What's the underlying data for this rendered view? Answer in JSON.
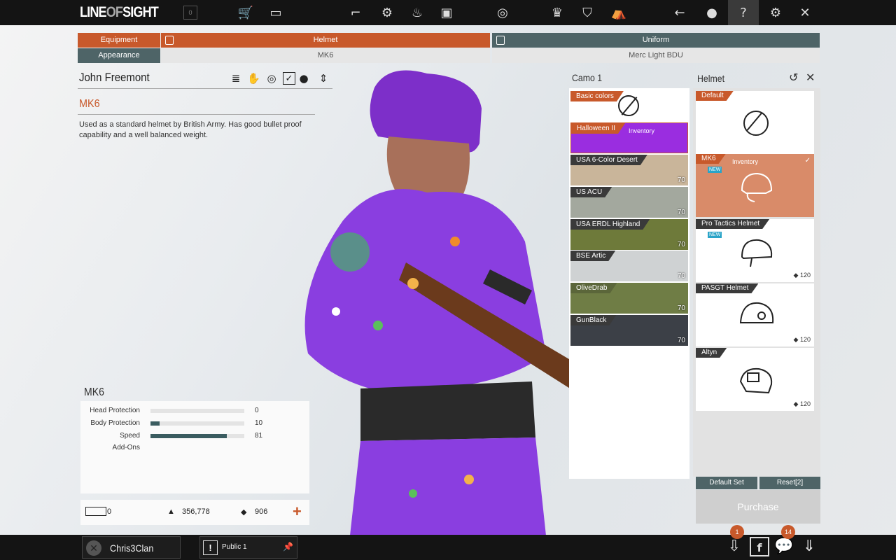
{
  "app": {
    "logo_left": "LINE",
    "logo_of": "OF",
    "logo_right": "SIGHT",
    "level": "0"
  },
  "tabs": {
    "equipment": "Equipment",
    "appearance": "Appearance",
    "helmet": "Helmet",
    "helmet_item": "MK6",
    "uniform": "Uniform",
    "uniform_item": "Merc Light BDU"
  },
  "character": {
    "name": "John Freemont"
  },
  "item": {
    "name": "MK6",
    "description": "Used as a standard helmet by British Army. Has good bullet proof capability and a well balanced weight."
  },
  "stats": {
    "title": "MK6",
    "rows": [
      {
        "label": "Head Protection",
        "value": "0",
        "fraction": 0
      },
      {
        "label": "Body Protection",
        "value": "10",
        "fraction": 0.1
      },
      {
        "label": "Speed",
        "value": "81",
        "fraction": 0.81
      }
    ],
    "addons_label": "Add-Ons"
  },
  "currency": {
    "coupons": "0",
    "gp": "356,778",
    "zp": "906",
    "plus": "+"
  },
  "camo": {
    "title": "Camo 1",
    "items": [
      {
        "name": "Basic colors",
        "price": "",
        "tag": ""
      },
      {
        "name": "Halloween II",
        "price": "",
        "tag": "Inventory"
      },
      {
        "name": "USA 6-Color Desert",
        "price": "70",
        "tag": ""
      },
      {
        "name": "US ACU",
        "price": "70",
        "tag": ""
      },
      {
        "name": "USA ERDL Highland",
        "price": "70",
        "tag": ""
      },
      {
        "name": "BSE Artic",
        "price": "70",
        "tag": ""
      },
      {
        "name": "OliveDrab",
        "price": "70",
        "tag": ""
      },
      {
        "name": "GunBlack",
        "price": "70",
        "tag": ""
      }
    ]
  },
  "helmet_panel": {
    "title": "Helmet",
    "items": [
      {
        "name": "Default",
        "price": "",
        "tag": "",
        "new": ""
      },
      {
        "name": "MK6",
        "price": "",
        "tag": "Inventory",
        "new": "NEW"
      },
      {
        "name": "Pro Tactics Helmet",
        "price": "120",
        "tag": "",
        "new": "NEW"
      },
      {
        "name": "PASGT Helmet",
        "price": "120",
        "tag": "",
        "new": ""
      },
      {
        "name": "Altyn",
        "price": "120",
        "tag": "",
        "new": ""
      }
    ],
    "default_set": "Default Set",
    "reset": "Reset[2]",
    "purchase": "Purchase"
  },
  "bottom": {
    "clan_name": "Chris3Clan",
    "chat_room": "Public 1",
    "download_badge": "1",
    "chat_badge": "14"
  },
  "colors": {
    "accent": "#c8592b",
    "teal": "#4e6467",
    "bar": "#141414"
  }
}
